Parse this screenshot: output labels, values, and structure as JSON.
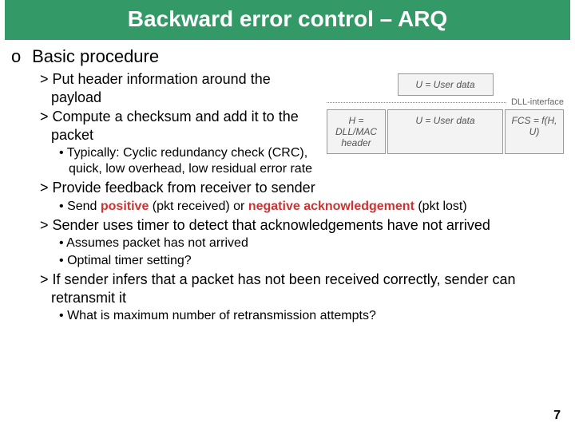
{
  "title": "Backward error control – ARQ",
  "section": "Basic procedure",
  "leftBullets": {
    "b1": "Put header information around the payload",
    "b2": "Compute a checksum and add it to the packet",
    "b2sub": "Typically: Cyclic redundancy check (CRC), quick, low overhead, low residual error rate"
  },
  "diagram": {
    "userData": "U = User data",
    "interface": "DLL-interface",
    "header": "H = DLL/MAC header",
    "userData2": "U = User data",
    "fcs": "FCS = f(H, U)"
  },
  "full": {
    "b3": "Provide feedback from receiver to sender",
    "b3subPrefix": "Send ",
    "b3subPos": "positive",
    "b3subMid": " (pkt received) or ",
    "b3subNeg": "negative acknowledgement",
    "b3subEnd": " (pkt lost)",
    "b4": "Sender uses timer to detect that acknowledgements have not arrived",
    "b4sub1": "Assumes packet has not arrived",
    "b4sub2": "Optimal timer setting?",
    "b5": "If sender infers that a packet has not been received correctly, sender can retransmit it",
    "b5sub": "What is maximum number of retransmission attempts?"
  },
  "markers": {
    "o": "o",
    "gt": ">",
    "dot": "•"
  },
  "pageNumber": "7"
}
